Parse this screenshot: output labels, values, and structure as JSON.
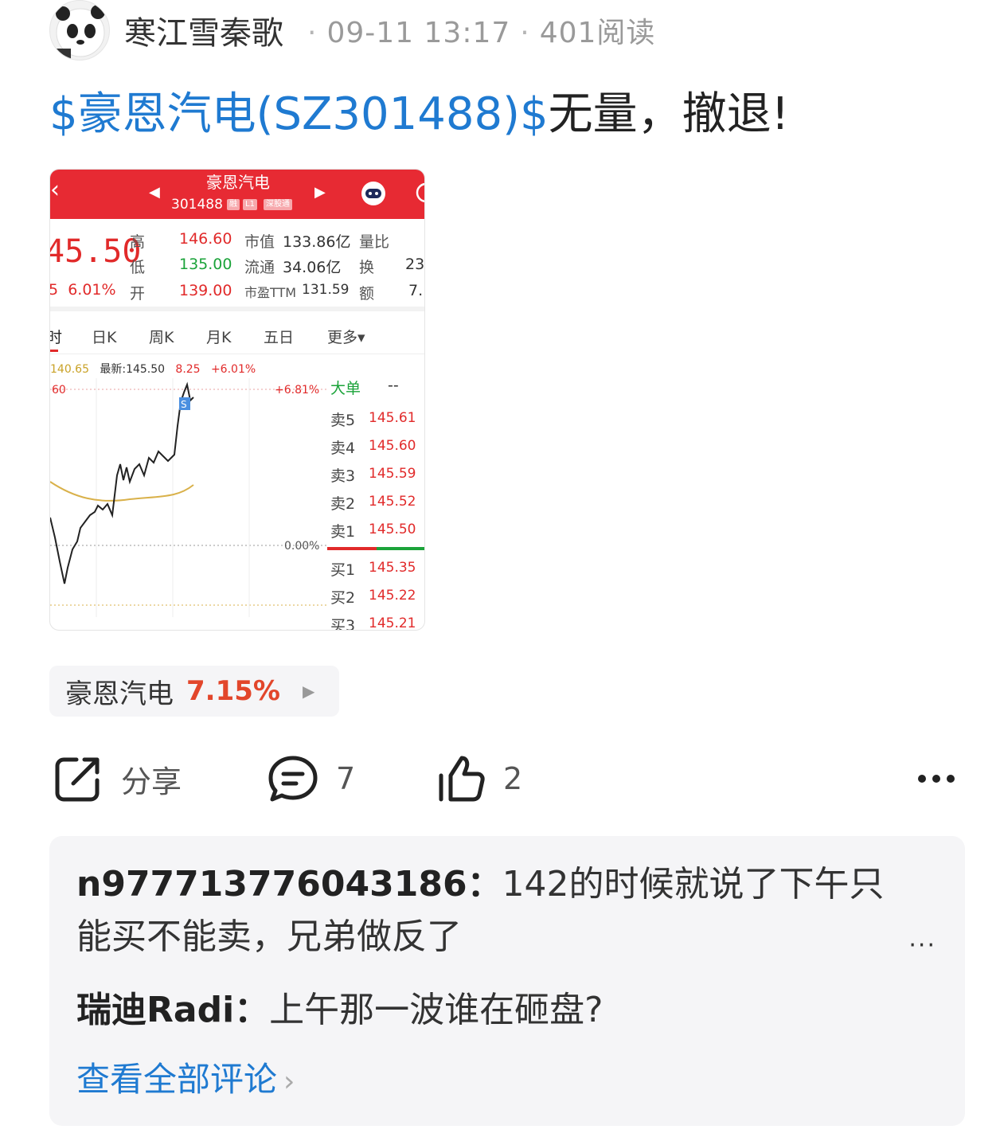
{
  "post": {
    "author": "寒江雪秦歌",
    "date": "09-11 13:17",
    "reads": "401阅读",
    "stock_link": "$豪恩汽电(SZ301488)$",
    "text": "无量，撤退!"
  },
  "screenshot": {
    "stock_name": "豪恩汽电",
    "stock_code": "301488",
    "tags": [
      "融",
      "L1",
      "深股通"
    ],
    "price": "45.50",
    "change_pct": "6.01%",
    "change_prefix": "5",
    "labels": {
      "high": "高",
      "low": "低",
      "open": "开",
      "mcap": "市值",
      "float": "流通",
      "pe": "市盈TTM",
      "vol_ratio": "量比",
      "turnover": "换",
      "amount": "额"
    },
    "values": {
      "high": "146.60",
      "low": "135.00",
      "open": "139.00",
      "mcap": "133.86亿",
      "float": "34.06亿",
      "pe": "131.59",
      "turnover": "23.",
      "amount": "7."
    },
    "tabs": [
      "时",
      "日K",
      "周K",
      "月K",
      "五日",
      "更多▾"
    ],
    "stat_line": {
      "avg": "140.65",
      "latest_label": "最新:145.50",
      "change": "8.25",
      "pct": "+6.01%"
    },
    "axis": {
      "top_left": "60",
      "top_right": "+6.81%",
      "zero": "0.00%"
    },
    "marker": "S",
    "order_book": {
      "title": "大单",
      "title_value": "--",
      "sells": [
        {
          "label": "卖5",
          "price": "145.61"
        },
        {
          "label": "卖4",
          "price": "145.60"
        },
        {
          "label": "卖3",
          "price": "145.59"
        },
        {
          "label": "卖2",
          "price": "145.52"
        },
        {
          "label": "卖1",
          "price": "145.50"
        }
      ],
      "buys": [
        {
          "label": "买1",
          "price": "145.35"
        },
        {
          "label": "买2",
          "price": "145.22"
        },
        {
          "label": "买3",
          "price": "145.21"
        }
      ]
    }
  },
  "stock_pill": {
    "name": "豪恩汽电",
    "pct": "7.15%"
  },
  "actions": {
    "share": "分享",
    "comments": "7",
    "likes": "2"
  },
  "comments": [
    {
      "user": "n977713776043186",
      "text": "142的时候就说了下午只能买不能卖，兄弟做反了"
    },
    {
      "user": "瑞迪Radi",
      "text": "上午那一波谁在砸盘?"
    }
  ],
  "view_all": "查看全部评论",
  "colors": {
    "link": "#1f7ad1",
    "up": "#e2462b",
    "header_red": "#e72a33",
    "green": "#1ba33a"
  }
}
